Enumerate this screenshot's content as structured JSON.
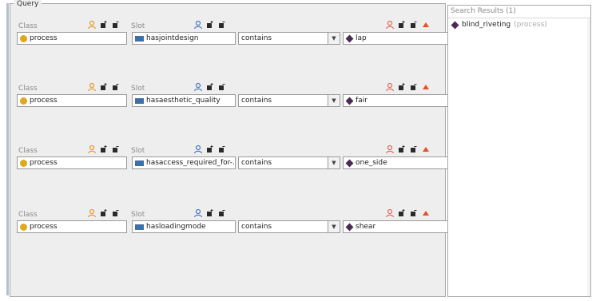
{
  "query": {
    "title": "Query",
    "labels": {
      "class": "Class",
      "slot": "Slot"
    },
    "operator_dropdown_icon": "chevron-down-icon",
    "rows": [
      {
        "class_value": "process",
        "slot_value": "hasjointdesign",
        "operator": "contains",
        "value": "lap"
      },
      {
        "class_value": "process",
        "slot_value": "hasaesthetic_quality",
        "operator": "contains",
        "value": "fair"
      },
      {
        "class_value": "process",
        "slot_value": "hasaccess_required_for-...",
        "operator": "contains",
        "value": "one_side"
      },
      {
        "class_value": "process",
        "slot_value": "hasloadingmode",
        "operator": "contains",
        "value": "shear"
      }
    ]
  },
  "search_results": {
    "title": "Search Results (1)",
    "items": [
      {
        "name": "blind_riveting",
        "type": "(process)"
      }
    ]
  },
  "colors": {
    "class_icon": "#e0a81e",
    "slot_icon": "#3e6fa7",
    "value_icon": "#4a2a57",
    "person_icon_orange": "#e89a2a",
    "person_icon_blue": "#4a78c0",
    "person_icon_red": "#e06a5a",
    "remove_icon": "#e8501e"
  }
}
